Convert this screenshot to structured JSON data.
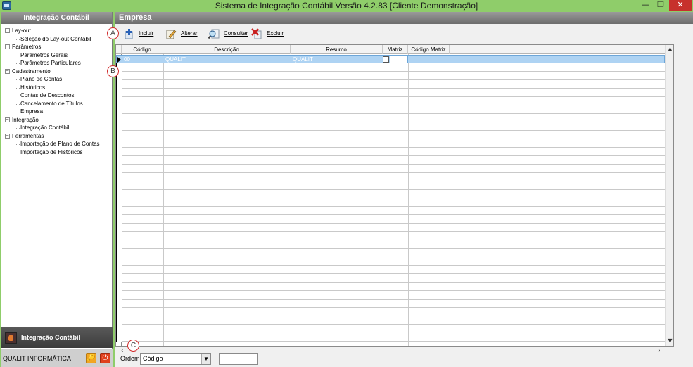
{
  "window": {
    "title": "Sistema de Integração Contábil Versão 4.2.83 [Cliente Demonstração]",
    "min_glyph": "—",
    "max_glyph": "❐",
    "close_glyph": "✕"
  },
  "sidebar": {
    "header": "Integração Contábil",
    "tree": [
      {
        "label": "Lay-out",
        "expander": "−",
        "children": [
          "Seleção do Lay-out Contábil"
        ]
      },
      {
        "label": "Parâmetros",
        "expander": "−",
        "children": [
          "Parâmetros Gerais",
          "Parâmetros Particulares"
        ]
      },
      {
        "label": "Cadastramento",
        "expander": "−",
        "children": [
          "Plano de Contas",
          "Históricos",
          "Contas de Descontos",
          "Cancelamento de Títulos",
          "Empresa"
        ]
      },
      {
        "label": "Integração",
        "expander": "−",
        "children": [
          "Integração Contábil"
        ]
      },
      {
        "label": "Ferramentas",
        "expander": "−",
        "children": [
          "Importação de Plano de Contas",
          "Importação de Históricos"
        ]
      }
    ],
    "module_label": "Integração Contábil",
    "company_label": "QUALIT INFORMÁTICA",
    "key_glyph": "🔑",
    "power_glyph": "⏻"
  },
  "main": {
    "title": "Empresa",
    "toolbar": {
      "incluir": "Incluir",
      "alterar": "Alterar",
      "consultar": "Consultar",
      "excluir": "Excluir"
    },
    "grid": {
      "columns": [
        "Código",
        "Descrição",
        "Resumo",
        "Matriz",
        "Código Matriz"
      ],
      "rows": [
        {
          "codigo": "00",
          "descricao": "QUALIT",
          "resumo": "QUALIT",
          "matriz": false,
          "codigo_matriz": ""
        }
      ]
    },
    "ordem_label": "Ordem",
    "ordem_value": "Código",
    "search_value": ""
  },
  "callouts": {
    "a": "A",
    "b": "B",
    "c": "C"
  },
  "icons": {
    "incluir": "add-icon",
    "alterar": "edit-icon",
    "consultar": "search-icon",
    "excluir": "delete-icon"
  }
}
